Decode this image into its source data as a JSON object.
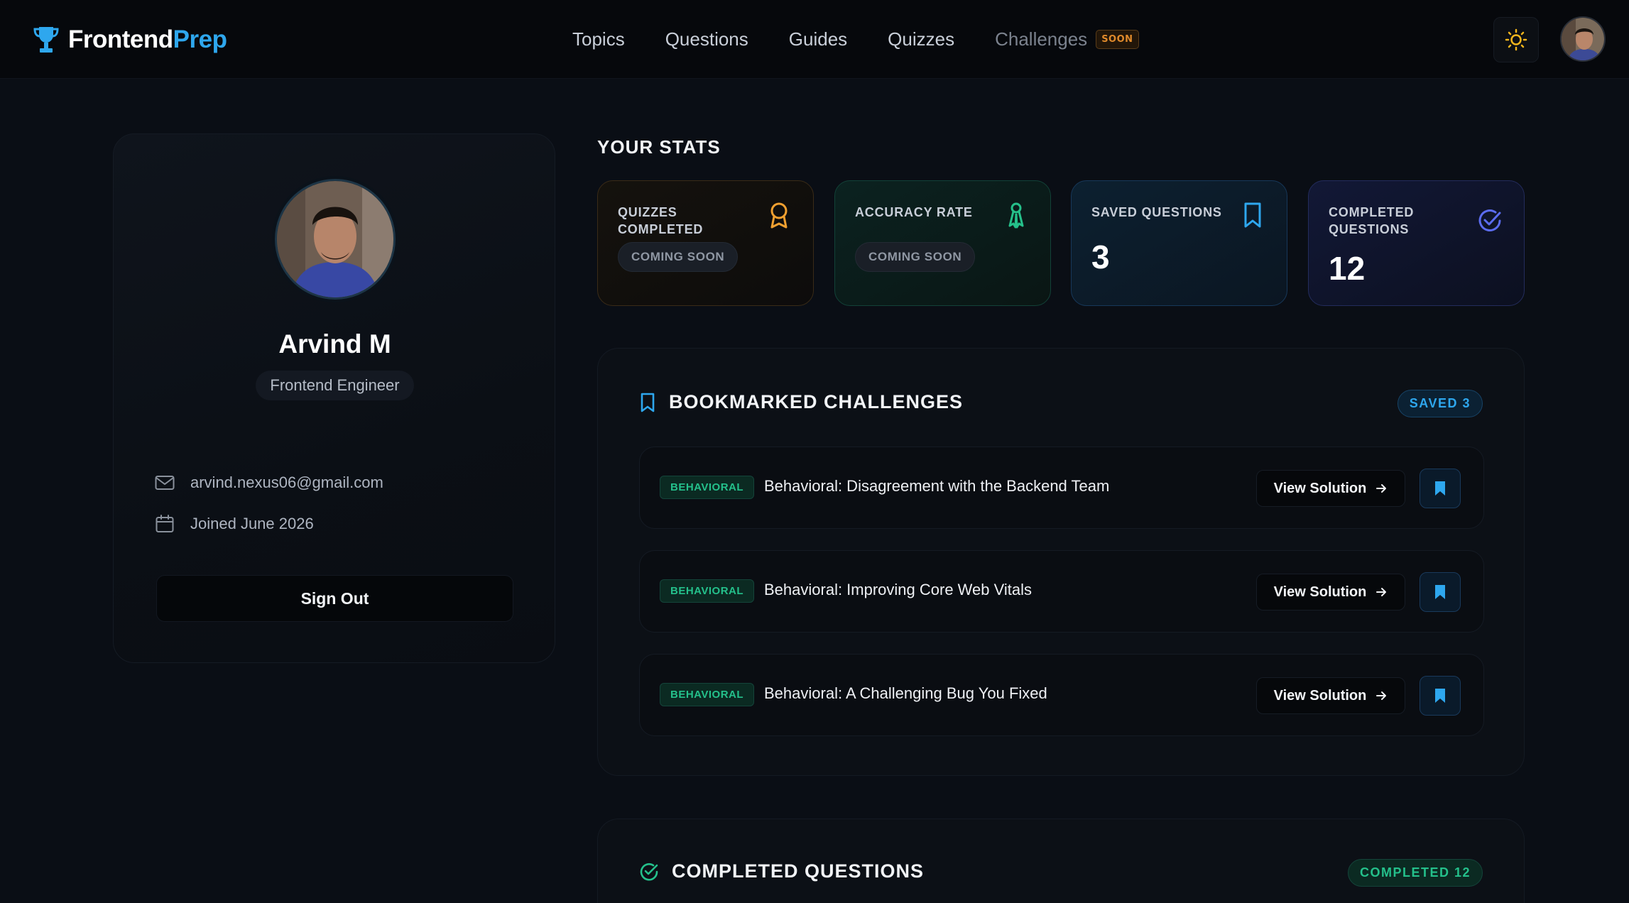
{
  "header": {
    "brand_part1": "Frontend",
    "brand_part2": "Prep",
    "nav": [
      "Topics",
      "Questions",
      "Guides",
      "Quizzes",
      "Challenges"
    ],
    "soon_badge": "SOON"
  },
  "profile": {
    "name": "Arvind M",
    "role": "Frontend Engineer",
    "email": "arvind.nexus06@gmail.com",
    "joined": "Joined June 2026",
    "sign_out": "Sign Out"
  },
  "stats": {
    "title": "YOUR STATS",
    "cards": [
      {
        "label": "QUIZZES COMPLETED",
        "value": "COMING SOON"
      },
      {
        "label": "ACCURACY RATE",
        "value": "COMING SOON"
      },
      {
        "label": "SAVED QUESTIONS",
        "value": "3"
      },
      {
        "label": "COMPLETED QUESTIONS",
        "value": "12"
      }
    ]
  },
  "bookmarked": {
    "title": "BOOKMARKED CHALLENGES",
    "badge": "SAVED 3",
    "items": [
      {
        "tag": "BEHAVIORAL",
        "title": "Behavioral: Disagreement with the Backend Team",
        "action": "View Solution"
      },
      {
        "tag": "BEHAVIORAL",
        "title": "Behavioral: Improving Core Web Vitals",
        "action": "View Solution"
      },
      {
        "tag": "BEHAVIORAL",
        "title": "Behavioral: A Challenging Bug You Fixed",
        "action": "View Solution"
      }
    ]
  },
  "completed": {
    "title": "COMPLETED QUESTIONS",
    "badge": "COMPLETED 12"
  },
  "colors": {
    "accent_blue": "#2ea7ee",
    "accent_green": "#24c08b",
    "accent_orange": "#e08a2b",
    "accent_indigo": "#5b6cf0"
  }
}
